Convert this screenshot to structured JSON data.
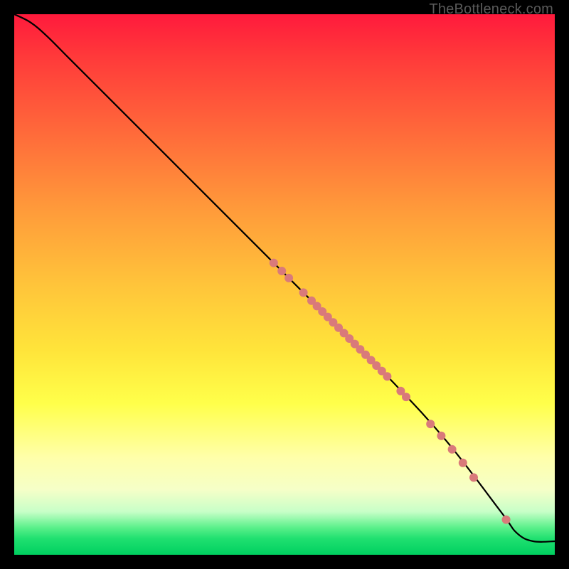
{
  "attribution": "TheBottleneck.com",
  "colors": {
    "dot": "#d97a7a",
    "curve": "#000000",
    "frame": "#000000"
  },
  "chart_data": {
    "type": "line",
    "title": "",
    "xlabel": "",
    "ylabel": "",
    "xlim": [
      0,
      100
    ],
    "ylim": [
      0,
      100
    ],
    "grid": false,
    "legend": false,
    "series": [
      {
        "name": "curve",
        "x": [
          0,
          3,
          6,
          10,
          15,
          20,
          30,
          40,
          50,
          60,
          70,
          80,
          90,
          93,
          96,
          100
        ],
        "y": [
          100,
          98.5,
          96,
          92,
          87,
          82,
          72,
          62,
          52,
          42,
          32,
          21,
          8,
          4,
          2.5,
          2.5
        ]
      }
    ],
    "points": [
      {
        "x": 48.0,
        "y": 54.0
      },
      {
        "x": 49.5,
        "y": 52.5
      },
      {
        "x": 50.8,
        "y": 51.2
      },
      {
        "x": 53.5,
        "y": 48.5
      },
      {
        "x": 55.0,
        "y": 47.0
      },
      {
        "x": 56.0,
        "y": 46.0
      },
      {
        "x": 57.0,
        "y": 45.0
      },
      {
        "x": 58.0,
        "y": 44.0
      },
      {
        "x": 59.0,
        "y": 43.0
      },
      {
        "x": 60.0,
        "y": 42.0
      },
      {
        "x": 61.0,
        "y": 41.0
      },
      {
        "x": 62.0,
        "y": 40.0
      },
      {
        "x": 63.0,
        "y": 39.0
      },
      {
        "x": 64.0,
        "y": 38.0
      },
      {
        "x": 65.0,
        "y": 37.0
      },
      {
        "x": 66.0,
        "y": 36.0
      },
      {
        "x": 67.0,
        "y": 35.0
      },
      {
        "x": 68.0,
        "y": 34.0
      },
      {
        "x": 69.0,
        "y": 33.0
      },
      {
        "x": 71.5,
        "y": 30.3
      },
      {
        "x": 72.5,
        "y": 29.2
      },
      {
        "x": 77.0,
        "y": 24.2
      },
      {
        "x": 79.0,
        "y": 22.0
      },
      {
        "x": 81.0,
        "y": 19.5
      },
      {
        "x": 83.0,
        "y": 17.0
      },
      {
        "x": 85.0,
        "y": 14.3
      },
      {
        "x": 91.0,
        "y": 6.5
      }
    ],
    "point_radius": 6
  }
}
